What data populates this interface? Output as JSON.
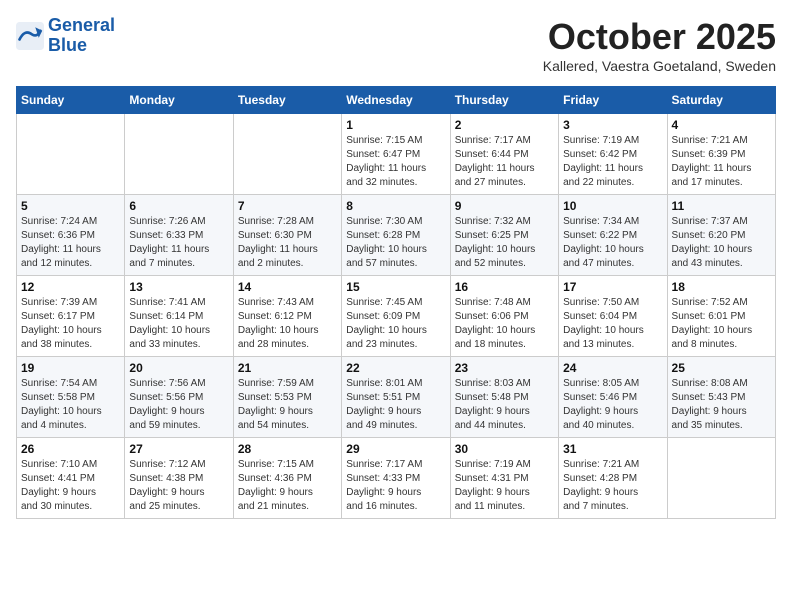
{
  "logo": {
    "line1": "General",
    "line2": "Blue"
  },
  "title": "October 2025",
  "subtitle": "Kallered, Vaestra Goetaland, Sweden",
  "weekdays": [
    "Sunday",
    "Monday",
    "Tuesday",
    "Wednesday",
    "Thursday",
    "Friday",
    "Saturday"
  ],
  "weeks": [
    [
      {
        "day": "",
        "detail": ""
      },
      {
        "day": "",
        "detail": ""
      },
      {
        "day": "",
        "detail": ""
      },
      {
        "day": "1",
        "detail": "Sunrise: 7:15 AM\nSunset: 6:47 PM\nDaylight: 11 hours\nand 32 minutes."
      },
      {
        "day": "2",
        "detail": "Sunrise: 7:17 AM\nSunset: 6:44 PM\nDaylight: 11 hours\nand 27 minutes."
      },
      {
        "day": "3",
        "detail": "Sunrise: 7:19 AM\nSunset: 6:42 PM\nDaylight: 11 hours\nand 22 minutes."
      },
      {
        "day": "4",
        "detail": "Sunrise: 7:21 AM\nSunset: 6:39 PM\nDaylight: 11 hours\nand 17 minutes."
      }
    ],
    [
      {
        "day": "5",
        "detail": "Sunrise: 7:24 AM\nSunset: 6:36 PM\nDaylight: 11 hours\nand 12 minutes."
      },
      {
        "day": "6",
        "detail": "Sunrise: 7:26 AM\nSunset: 6:33 PM\nDaylight: 11 hours\nand 7 minutes."
      },
      {
        "day": "7",
        "detail": "Sunrise: 7:28 AM\nSunset: 6:30 PM\nDaylight: 11 hours\nand 2 minutes."
      },
      {
        "day": "8",
        "detail": "Sunrise: 7:30 AM\nSunset: 6:28 PM\nDaylight: 10 hours\nand 57 minutes."
      },
      {
        "day": "9",
        "detail": "Sunrise: 7:32 AM\nSunset: 6:25 PM\nDaylight: 10 hours\nand 52 minutes."
      },
      {
        "day": "10",
        "detail": "Sunrise: 7:34 AM\nSunset: 6:22 PM\nDaylight: 10 hours\nand 47 minutes."
      },
      {
        "day": "11",
        "detail": "Sunrise: 7:37 AM\nSunset: 6:20 PM\nDaylight: 10 hours\nand 43 minutes."
      }
    ],
    [
      {
        "day": "12",
        "detail": "Sunrise: 7:39 AM\nSunset: 6:17 PM\nDaylight: 10 hours\nand 38 minutes."
      },
      {
        "day": "13",
        "detail": "Sunrise: 7:41 AM\nSunset: 6:14 PM\nDaylight: 10 hours\nand 33 minutes."
      },
      {
        "day": "14",
        "detail": "Sunrise: 7:43 AM\nSunset: 6:12 PM\nDaylight: 10 hours\nand 28 minutes."
      },
      {
        "day": "15",
        "detail": "Sunrise: 7:45 AM\nSunset: 6:09 PM\nDaylight: 10 hours\nand 23 minutes."
      },
      {
        "day": "16",
        "detail": "Sunrise: 7:48 AM\nSunset: 6:06 PM\nDaylight: 10 hours\nand 18 minutes."
      },
      {
        "day": "17",
        "detail": "Sunrise: 7:50 AM\nSunset: 6:04 PM\nDaylight: 10 hours\nand 13 minutes."
      },
      {
        "day": "18",
        "detail": "Sunrise: 7:52 AM\nSunset: 6:01 PM\nDaylight: 10 hours\nand 8 minutes."
      }
    ],
    [
      {
        "day": "19",
        "detail": "Sunrise: 7:54 AM\nSunset: 5:58 PM\nDaylight: 10 hours\nand 4 minutes."
      },
      {
        "day": "20",
        "detail": "Sunrise: 7:56 AM\nSunset: 5:56 PM\nDaylight: 9 hours\nand 59 minutes."
      },
      {
        "day": "21",
        "detail": "Sunrise: 7:59 AM\nSunset: 5:53 PM\nDaylight: 9 hours\nand 54 minutes."
      },
      {
        "day": "22",
        "detail": "Sunrise: 8:01 AM\nSunset: 5:51 PM\nDaylight: 9 hours\nand 49 minutes."
      },
      {
        "day": "23",
        "detail": "Sunrise: 8:03 AM\nSunset: 5:48 PM\nDaylight: 9 hours\nand 44 minutes."
      },
      {
        "day": "24",
        "detail": "Sunrise: 8:05 AM\nSunset: 5:46 PM\nDaylight: 9 hours\nand 40 minutes."
      },
      {
        "day": "25",
        "detail": "Sunrise: 8:08 AM\nSunset: 5:43 PM\nDaylight: 9 hours\nand 35 minutes."
      }
    ],
    [
      {
        "day": "26",
        "detail": "Sunrise: 7:10 AM\nSunset: 4:41 PM\nDaylight: 9 hours\nand 30 minutes."
      },
      {
        "day": "27",
        "detail": "Sunrise: 7:12 AM\nSunset: 4:38 PM\nDaylight: 9 hours\nand 25 minutes."
      },
      {
        "day": "28",
        "detail": "Sunrise: 7:15 AM\nSunset: 4:36 PM\nDaylight: 9 hours\nand 21 minutes."
      },
      {
        "day": "29",
        "detail": "Sunrise: 7:17 AM\nSunset: 4:33 PM\nDaylight: 9 hours\nand 16 minutes."
      },
      {
        "day": "30",
        "detail": "Sunrise: 7:19 AM\nSunset: 4:31 PM\nDaylight: 9 hours\nand 11 minutes."
      },
      {
        "day": "31",
        "detail": "Sunrise: 7:21 AM\nSunset: 4:28 PM\nDaylight: 9 hours\nand 7 minutes."
      },
      {
        "day": "",
        "detail": ""
      }
    ]
  ]
}
